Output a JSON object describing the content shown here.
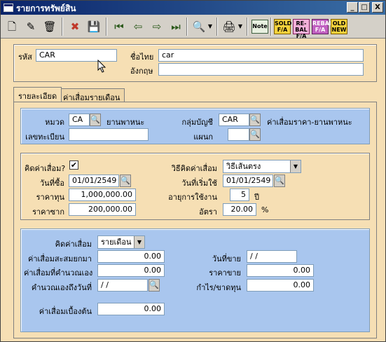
{
  "window": {
    "title": "รายการทรัพย์สิน",
    "controls": {
      "minimize": "_",
      "maximize": "□",
      "close": "X"
    }
  },
  "toolbar": {
    "buttons": [
      {
        "name": "new-icon",
        "glyph": "🗋"
      },
      {
        "name": "edit-icon",
        "glyph": "✎"
      },
      {
        "name": "delete-icon",
        "glyph": "🗑"
      },
      {
        "name": "cancel-icon",
        "glyph": "✖"
      },
      {
        "name": "save-icon",
        "glyph": "💾"
      },
      {
        "name": "first-record-icon",
        "glyph": "⏮"
      },
      {
        "name": "previous-record-icon",
        "glyph": "⇦"
      },
      {
        "name": "next-record-icon",
        "glyph": "⇨"
      },
      {
        "name": "last-record-icon",
        "glyph": "⏭"
      },
      {
        "name": "search-icon",
        "glyph": "🔍"
      },
      {
        "name": "print-icon",
        "glyph": "🖨"
      },
      {
        "name": "note-icon",
        "label": "Note"
      },
      {
        "name": "sold-fa-icon",
        "label": "SOLD F/A"
      },
      {
        "name": "rebal-fa-icon",
        "label": "RE-BAL F/A"
      },
      {
        "name": "rebal-fa-2-icon",
        "label": "REBAL F/A"
      },
      {
        "name": "old-new-icon",
        "label": "OLD NEW"
      }
    ]
  },
  "header": {
    "code_label": "รหัส",
    "code_value": "CAR",
    "thai_name_label": "ชื่อไทย",
    "thai_name_value": "car",
    "english_name_label": "อังกฤษ",
    "english_name_value": ""
  },
  "tabs": [
    {
      "label": "รายละเอียด",
      "active": true
    },
    {
      "label": "ค่าเสื่อมรายเดือน",
      "active": false
    }
  ],
  "category": {
    "category_label": "หมวด",
    "category_value": "CA",
    "category_desc": "ยานพาหนะ",
    "account_group_label": "กลุ่มบัญชี",
    "account_group_value": "CAR",
    "account_group_desc": "ค่าเสื่อมราคา-ยานพาหนะ",
    "registration_label": "เลขทะเบียน",
    "registration_value": "",
    "department_label": "แผนก",
    "department_value": ""
  },
  "depreciation": {
    "calc_label": "คิดค่าเสื่อม?",
    "calc_checked": true,
    "check_glyph": "✔",
    "method_label": "วิธีคิดค่าเสื่อม",
    "method_value": "วิธีเส้นตรง",
    "purchase_date_label": "วันที่ซื้อ",
    "purchase_date_value": "01/01/2549",
    "start_date_label": "วันที่เริ่มใช้",
    "start_date_value": "01/01/2549",
    "cost_label": "ราคาทุน",
    "cost_value": "1,000,000.00",
    "useful_life_label": "อายุการใช้งาน",
    "useful_life_value": "5",
    "useful_life_unit": "ปี",
    "salvage_label": "ราคาซาก",
    "salvage_value": "200,000.00",
    "rate_label": "อัตรา",
    "rate_value": "20.00",
    "rate_unit": "%"
  },
  "summary": {
    "calc_period_label": "คิดค่าเสื่อม",
    "calc_period_value": "รายเดือน",
    "accumulated_label": "ค่าเสื่อมสะสมยกมา",
    "accumulated_value": "0.00",
    "sale_date_label": "วันที่ขาย",
    "sale_date_value": "/ /",
    "manual_label": "ค่าเสื่อมที่คำนวณเอง",
    "manual_value": "0.00",
    "sale_price_label": "ราคาขาย",
    "sale_price_value": "0.00",
    "manual_until_label": "คำนวณเองถึงวันที่",
    "manual_until_value": "/ /",
    "profit_loss_label": "กำไร/ขาดทุน",
    "profit_loss_value": "0.00",
    "initial_label": "ค่าเสื่อมเบื้องต้น",
    "initial_value": "0.00"
  },
  "icons": {
    "lookup": "🔍",
    "dropdown": "▼",
    "window": "app-window-icon"
  },
  "colors": {
    "title_bar": "#0a246a",
    "form_bg": "#f6dfb4",
    "blue_panel": "#a9c6ee"
  }
}
